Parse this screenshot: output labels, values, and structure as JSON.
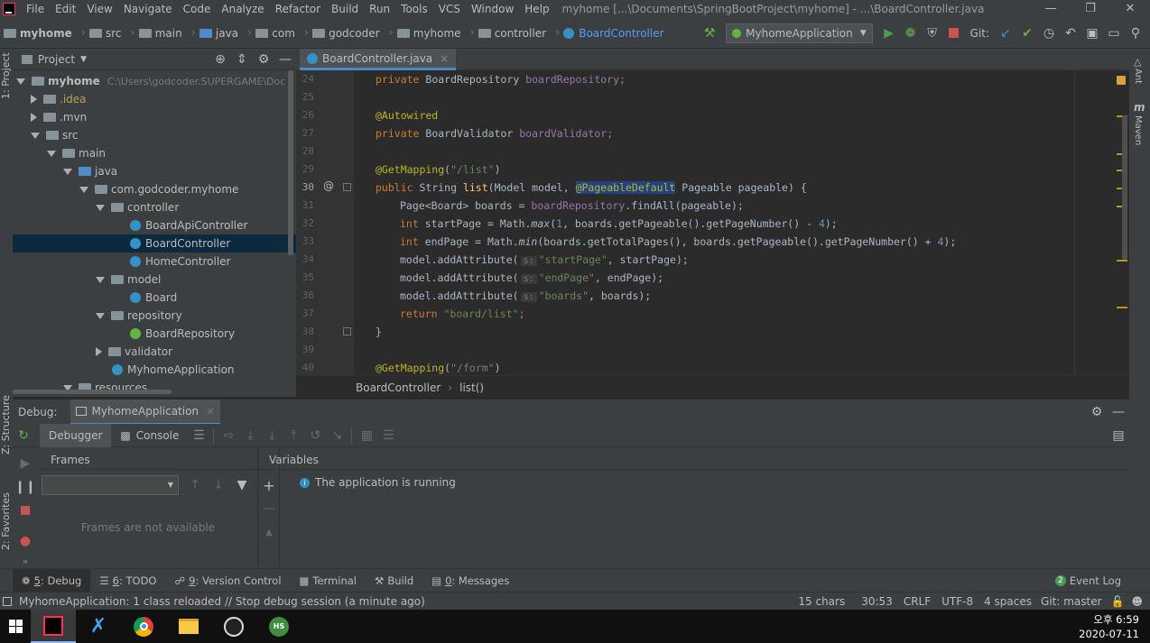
{
  "menubar": {
    "items": [
      "File",
      "Edit",
      "View",
      "Navigate",
      "Code",
      "Analyze",
      "Refactor",
      "Build",
      "Run",
      "Tools",
      "VCS",
      "Window",
      "Help"
    ],
    "window_title": "myhome [...\\Documents\\SpringBootProject\\myhome] - ...\\BoardController.java"
  },
  "navbar": {
    "breadcrumbs": [
      "myhome",
      "src",
      "main",
      "java",
      "com",
      "godcoder",
      "myhome",
      "controller",
      "BoardController"
    ],
    "run_config": "MyhomeApplication",
    "git_label": "Git:"
  },
  "project": {
    "title": "Project",
    "root": "myhome",
    "root_path": "C:\\Users\\godcoder.SUPERGAME\\Doc",
    "tree": [
      {
        "label": ".idea",
        "depth": 1,
        "type": "folder",
        "state": "collapsed"
      },
      {
        "label": ".mvn",
        "depth": 1,
        "type": "folder",
        "state": "collapsed"
      },
      {
        "label": "src",
        "depth": 1,
        "type": "folder",
        "state": "expanded"
      },
      {
        "label": "main",
        "depth": 2,
        "type": "folder",
        "state": "expanded"
      },
      {
        "label": "java",
        "depth": 3,
        "type": "folder",
        "state": "expanded"
      },
      {
        "label": "com.godcoder.myhome",
        "depth": 4,
        "type": "package",
        "state": "expanded"
      },
      {
        "label": "controller",
        "depth": 5,
        "type": "package",
        "state": "expanded"
      },
      {
        "label": "BoardApiController",
        "depth": 6,
        "type": "class"
      },
      {
        "label": "BoardController",
        "depth": 6,
        "type": "class",
        "selected": true
      },
      {
        "label": "HomeController",
        "depth": 6,
        "type": "class"
      },
      {
        "label": "model",
        "depth": 5,
        "type": "package",
        "state": "expanded"
      },
      {
        "label": "Board",
        "depth": 6,
        "type": "class"
      },
      {
        "label": "repository",
        "depth": 5,
        "type": "package",
        "state": "expanded"
      },
      {
        "label": "BoardRepository",
        "depth": 6,
        "type": "interface"
      },
      {
        "label": "validator",
        "depth": 5,
        "type": "package",
        "state": "collapsed"
      },
      {
        "label": "MyhomeApplication",
        "depth": 5,
        "type": "class"
      },
      {
        "label": "resources",
        "depth": 3,
        "type": "folder",
        "state": "expanded"
      }
    ]
  },
  "editor": {
    "tab": "BoardController.java",
    "line_numbers": [
      "24",
      "25",
      "26",
      "27",
      "28",
      "29",
      "30",
      "31",
      "32",
      "33",
      "34",
      "35",
      "36",
      "37",
      "38",
      "39",
      "40"
    ],
    "hint_s": "s:",
    "code": {
      "l24_kw": "private ",
      "l24_type": "BoardRepository ",
      "l24_field": "boardRepository",
      "l24_end": ";",
      "l26_an": "@Autowired",
      "l27_kw": "private ",
      "l27_type": "BoardValidator ",
      "l27_field": "boardValidator",
      "l27_end": ";",
      "l29_an": "@GetMapping",
      "l29_open": "(",
      "l29_str": "\"/list\"",
      "l29_close": ")",
      "l30_kw": "public ",
      "l30_a": "String ",
      "l30_fn": "list",
      "l30_b": "(Model model, ",
      "l30_sel": "@PageableDefault",
      "l30_c": " Pageable pageable) {",
      "l31_a": "Page<Board> boards = ",
      "l31_field": "boardRepository",
      "l31_b": ".findAll(pageable);",
      "l32_kw": "int ",
      "l32_a": "startPage = Math.",
      "l32_fn": "max",
      "l32_b": "(",
      "l32_n1": "1",
      "l32_c": ", boards.getPageable().getPageNumber() - ",
      "l32_n2": "4",
      "l32_d": ");",
      "l33_kw": "int ",
      "l33_a": "endPage = Math.",
      "l33_fn": "min",
      "l33_b": "(boards.getTotalPages(), boards.getPageable().getPageNumber() + ",
      "l33_n": "4",
      "l33_c": ");",
      "l34_a": "model.addAttribute(",
      "l34_str": "\"startPage\"",
      "l34_b": ", startPage);",
      "l35_a": "model.addAttribute(",
      "l35_str": "\"endPage\"",
      "l35_b": ", endPage);",
      "l36_a": "model.addAttribute(",
      "l36_str": "\"boards\"",
      "l36_b": ", boards);",
      "l37_kw": "return ",
      "l37_str": "\"board/list\"",
      "l37_end": ";",
      "l38": "}",
      "l40_an": "@GetMapping",
      "l40_open": "(",
      "l40_str": "\"/form\"",
      "l40_close": ")"
    },
    "breadcrumb_class": "BoardController",
    "breadcrumb_method": "list()"
  },
  "debug": {
    "label": "Debug:",
    "session_tab": "MyhomeApplication",
    "tabs": [
      "Debugger",
      "Console"
    ],
    "frames_title": "Frames",
    "frames_empty": "Frames are not available",
    "variables_title": "Variables",
    "variables_msg": "The application is running"
  },
  "toolwindows": {
    "debug": {
      "num": "5",
      "label": ": Debug"
    },
    "todo": {
      "num": "6",
      "label": ": TODO"
    },
    "vcs": {
      "num": "9",
      "label": ": Version Control"
    },
    "terminal": "Terminal",
    "build": "Build",
    "messages": {
      "num": "0",
      "label": ": Messages"
    },
    "event_log_count": "2",
    "event_log": "Event Log"
  },
  "left_strip": {
    "project": "1: Project",
    "structure": "Z: Structure",
    "favorites": "2: Favorites"
  },
  "right_strip": {
    "ant": "Ant",
    "maven": "Maven"
  },
  "status": {
    "message": "MyhomeApplication: 1 class reloaded // Stop debug session (a minute ago)",
    "chars": "15 chars",
    "position": "30:53",
    "line_sep": "CRLF",
    "encoding": "UTF-8",
    "indent": "4 spaces",
    "git": "Git: master"
  },
  "taskbar": {
    "time": "오후 6:59",
    "date": "2020-07-11",
    "hs_label": "HS"
  },
  "colors": {
    "accent": "#4a88c7",
    "keyword": "#cc7832",
    "annotation": "#bbb529",
    "string": "#6a8759",
    "field": "#9876aa",
    "number": "#6897bb"
  }
}
